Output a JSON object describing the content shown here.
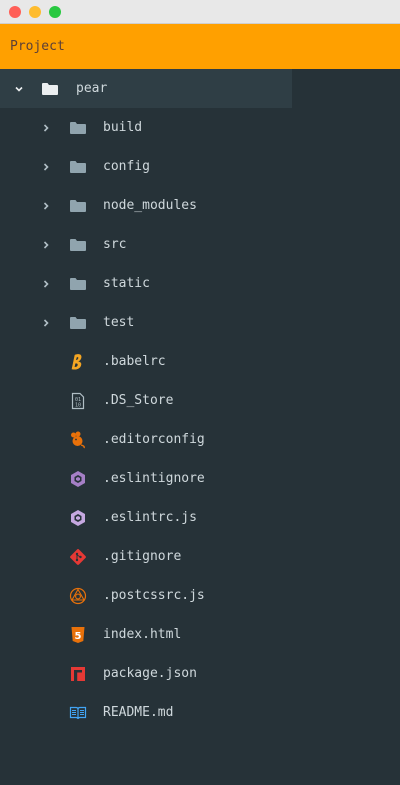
{
  "window": {
    "traffic_lights": [
      "#ff5f57",
      "#febc2e",
      "#28c840"
    ]
  },
  "header": {
    "title": "Project"
  },
  "tree": {
    "root": {
      "label": "pear"
    },
    "folders": [
      {
        "label": "build"
      },
      {
        "label": "config"
      },
      {
        "label": "node_modules"
      },
      {
        "label": "src"
      },
      {
        "label": "static"
      },
      {
        "label": "test"
      }
    ],
    "files": [
      {
        "label": ".babelrc",
        "icon": "babel-icon"
      },
      {
        "label": ".DS_Store",
        "icon": "ds-store-icon"
      },
      {
        "label": ".editorconfig",
        "icon": "editorconfig-icon"
      },
      {
        "label": ".eslintignore",
        "icon": "eslint-icon"
      },
      {
        "label": ".eslintrc.js",
        "icon": "eslint-icon"
      },
      {
        "label": ".gitignore",
        "icon": "git-icon"
      },
      {
        "label": ".postcssrc.js",
        "icon": "postcss-icon"
      },
      {
        "label": "index.html",
        "icon": "html5-icon"
      },
      {
        "label": "package.json",
        "icon": "npm-icon"
      },
      {
        "label": "README.md",
        "icon": "readme-book-icon"
      }
    ]
  },
  "colors": {
    "background": "#263238",
    "header": "#ffa000",
    "selected_row": "#2f3e45",
    "folder_icon": "#90a4ae",
    "root_folder_icon": "#eceff1"
  }
}
